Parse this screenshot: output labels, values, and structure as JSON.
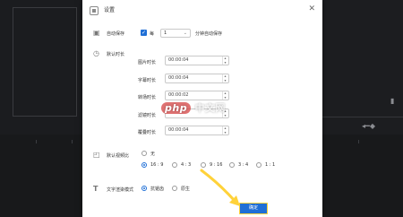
{
  "dialog": {
    "title": "设置",
    "close_glyph": "✕"
  },
  "autosave": {
    "label": "自动保存",
    "checkbox_label": "每",
    "interval_value": "1",
    "suffix": "分钟自动保存"
  },
  "default_duration": {
    "label": "默认时长",
    "fields": [
      {
        "label": "图片时长",
        "value": "00:00:04"
      },
      {
        "label": "字幕时长",
        "value": "00:00:04"
      },
      {
        "label": "转场时长",
        "value": "00:00:02"
      },
      {
        "label": "滤镜时长",
        "value": ""
      },
      {
        "label": "覆叠时长",
        "value": "00:00:04"
      }
    ]
  },
  "aspect_ratio": {
    "label": "默认视频比",
    "options": [
      "无",
      "16 : 9",
      "4 : 3",
      "9 : 16",
      "3 : 4",
      "1 : 1"
    ],
    "selected": "16 : 9"
  },
  "text_render": {
    "label": "文字渲染模式",
    "options": [
      "抗锯齿",
      "原生"
    ],
    "selected": "抗锯齿"
  },
  "confirm_label": "确定",
  "watermark": {
    "brand": "php",
    "text": "中文网"
  },
  "colors": {
    "accent": "#1f6fd6",
    "highlight": "#ffd23a",
    "background": "#202124"
  },
  "icons": {
    "autosave": "floppy-disk-icon",
    "duration": "clock-icon",
    "ratio": "aspect-ratio-icon",
    "text": "text-t-icon"
  }
}
